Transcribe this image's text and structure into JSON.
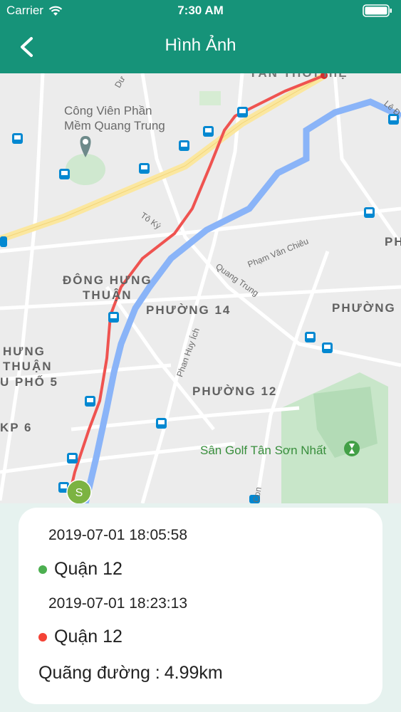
{
  "status_bar": {
    "carrier": "Carrier",
    "time": "7:30 AM"
  },
  "nav": {
    "title": "Hình Ảnh",
    "back_icon": "chevron-left-icon"
  },
  "map": {
    "labels": {
      "park": "Công Viên Phần\nMềm Quang Trung",
      "dong_hung_thuan": "ĐÔNG HƯNG\nTHUẬN",
      "phuong_14": "PHƯỜNG 14",
      "phuong_right": "PHƯỜNG",
      "ph_right": "PH",
      "hung_thuan": "HƯNG\nTHUẬN",
      "pho5": "U PHỐ 5",
      "kp6": "KP 6",
      "phuong_12": "PHƯỜNG 12",
      "golf": "Sân Golf Tân Sơn Nhất",
      "to_ky": "Tô Ký",
      "pham_van_chieu": "Phạm Văn Chiêu",
      "quang_trung": "Quang Trung",
      "phan_huy_ich": "Phan Huy Ích",
      "le_duc": "Lê Đ",
      "du": "Dư",
      "con": "Con",
      "tan_thoi_hiep": "TÂN THỚI HIỆ",
      "start_marker": "S"
    },
    "colors": {
      "route": "#ef5350",
      "water": "#8ab4f8",
      "park": "#c8e6c9",
      "highway": "#fbe79f"
    }
  },
  "trip": {
    "start_time": "2019-07-01 18:05:58",
    "start_place": "Quận 12",
    "end_time": "2019-07-01 18:23:13",
    "end_place": "Quận 12",
    "distance_label": "Quãng đường :",
    "distance_value": "4.99km",
    "start_color": "#4caf50",
    "end_color": "#f44336"
  }
}
